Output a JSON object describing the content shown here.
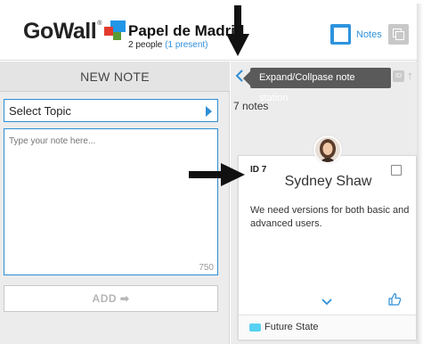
{
  "header": {
    "logo_text": "GoWall",
    "logo_reg": "®",
    "board_title": "Papel de Madrid",
    "participants_count": "2 people",
    "participants_present": "(1 present)",
    "notes_label": "Notes"
  },
  "left_panel": {
    "title": "NEW NOTE",
    "select_topic": "Select Topic",
    "note_placeholder": "Type your note here...",
    "char_count": "750",
    "add_button": "ADD ➡"
  },
  "right_panel": {
    "tooltip": "Expand/Collpase note station",
    "id_toggle": "ID",
    "notes_count": "7 notes",
    "card": {
      "id": "ID 7",
      "author": "Sydney Shaw",
      "body": "We need versions for both basic and advanced users.",
      "tag": "Future State"
    }
  },
  "colors": {
    "accent": "#2e93dd",
    "tag": "#58d1f2",
    "tooltip_bg": "#5a5a5a"
  }
}
